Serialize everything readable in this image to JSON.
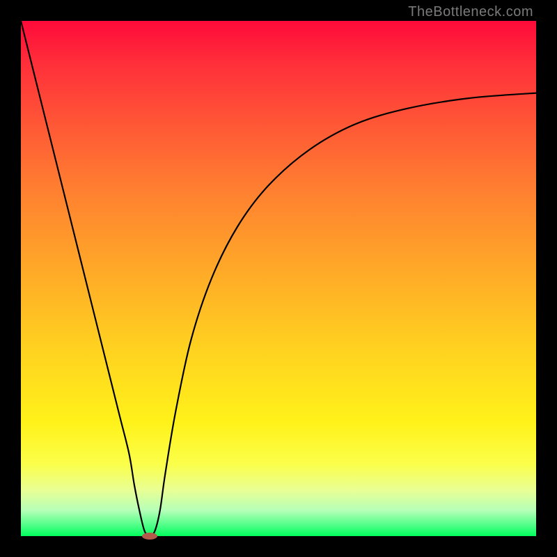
{
  "watermark": "TheBottleneck.com",
  "chart_data": {
    "type": "line",
    "title": "",
    "xlabel": "",
    "ylabel": "",
    "xlim": [
      0,
      100
    ],
    "ylim": [
      0,
      100
    ],
    "grid": false,
    "legend": false,
    "series": [
      {
        "name": "curve",
        "x": [
          0,
          5,
          10,
          15,
          19,
          21,
          22,
          23,
          24,
          25,
          26,
          27,
          28,
          30,
          33,
          37,
          42,
          48,
          56,
          65,
          75,
          87,
          100
        ],
        "values": [
          100,
          80,
          60,
          40,
          24,
          16,
          10,
          5,
          1,
          0,
          1,
          5,
          12,
          24,
          38,
          50,
          60,
          68,
          75,
          80,
          83,
          85,
          86
        ]
      }
    ],
    "marker": {
      "name": "bottleneck-point",
      "x": 25,
      "y": 0,
      "color": "#b35a4a",
      "rx": 11,
      "ry": 5
    },
    "background_gradient": [
      {
        "stop": 0,
        "color": "#ff0a3a"
      },
      {
        "stop": 50,
        "color": "#ffb020"
      },
      {
        "stop": 80,
        "color": "#fff21a"
      },
      {
        "stop": 100,
        "color": "#00ff5c"
      }
    ]
  }
}
